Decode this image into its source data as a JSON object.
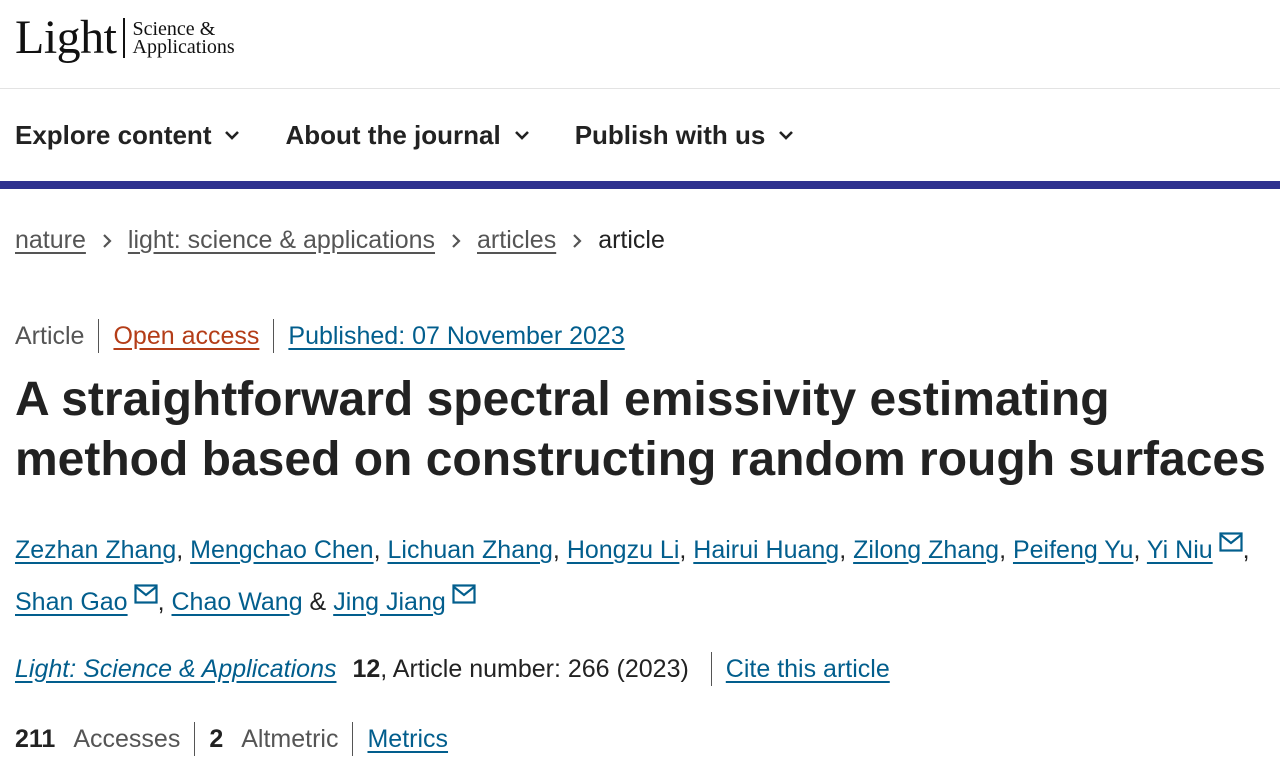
{
  "logo": {
    "main": "Light",
    "sub_line1": "Science &",
    "sub_line2": "Applications"
  },
  "nav": {
    "explore": "Explore content",
    "about": "About the journal",
    "publish": "Publish with us"
  },
  "breadcrumb": {
    "nature": "nature",
    "journal": "light: science & applications",
    "articles": "articles",
    "current": "article"
  },
  "meta": {
    "type": "Article",
    "open_access": "Open access",
    "published": "Published: 07 November 2023"
  },
  "title": "A straightforward spectral emissivity estimating method based on constructing random rough surfaces",
  "authors": {
    "a1": "Zezhan Zhang",
    "a2": "Mengchao Chen",
    "a3": "Lichuan Zhang",
    "a4": "Hongzu Li",
    "a5": "Hairui Huang",
    "a6": "Zilong Zhang",
    "a7": "Peifeng Yu",
    "a8": "Yi Niu",
    "a9": "Shan Gao",
    "a10": "Chao Wang",
    "a11": "Jing Jiang",
    "comma": ",",
    "amp": "&"
  },
  "citation": {
    "journal": "Light: Science & Applications",
    "volume": "12",
    "article_number": ", Article number: 266 (2023)",
    "cite": "Cite this article"
  },
  "stats": {
    "accesses_count": "211",
    "accesses_label": "Accesses",
    "altmetric_count": "2",
    "altmetric_label": "Altmetric",
    "metrics": "Metrics"
  },
  "colors": {
    "link": "#025e8d",
    "open_access": "#b43d18",
    "rule": "#2e318f"
  }
}
